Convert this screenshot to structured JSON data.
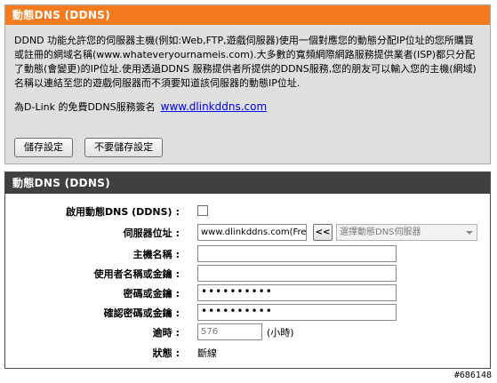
{
  "intro_panel": {
    "title": "動態DNS (DDNS)",
    "description": "DDND 功能允許您的伺服器主機(例如:Web,FTP,遊戲伺服器)使用一個對應您的動態分配IP位址的您所購買或註冊的網域名稱(www.whateveryournameis.com).大多數的寬頻網際網路服務提供業者(ISP)都只分配了動態(會變更)的IP位址.使用透過DDNS 服務提供者所提供的DDNS服務,您的朋友可以輸入您的主機(網域)名稱以連結至您的遊戲伺服器而不須要知道該伺服器的動態IP位址.",
    "signup_text": "為D-Link 的免費DDNS服務簽名",
    "signup_link": "www.dlinkddns.com",
    "save_button": "儲存設定",
    "dont_save_button": "不要儲存設定"
  },
  "ddns_panel": {
    "title": "動態DNS (DDNS)",
    "enable_label": "啟用動態DNS (DDNS)",
    "server_label": "伺服器位址",
    "server_value": "www.dlinkddns.com(Free)",
    "arrow_label": "<<",
    "server_select_placeholder": "選擇動態DNS伺服器",
    "hostname_label": "主機名稱",
    "hostname_value": "",
    "username_label": "使用者名稱或金鑰",
    "username_value": "",
    "password_label": "密碼或金鑰",
    "password_value": "••••••••••",
    "verify_label": "確認密碼或金鑰",
    "verify_value": "••••••••••",
    "timeout_label": "逾時",
    "timeout_value": "576",
    "timeout_unit": "(小時)",
    "status_label": "狀態",
    "status_value": "斷線",
    "colon": ":"
  },
  "watermark": "#686148"
}
